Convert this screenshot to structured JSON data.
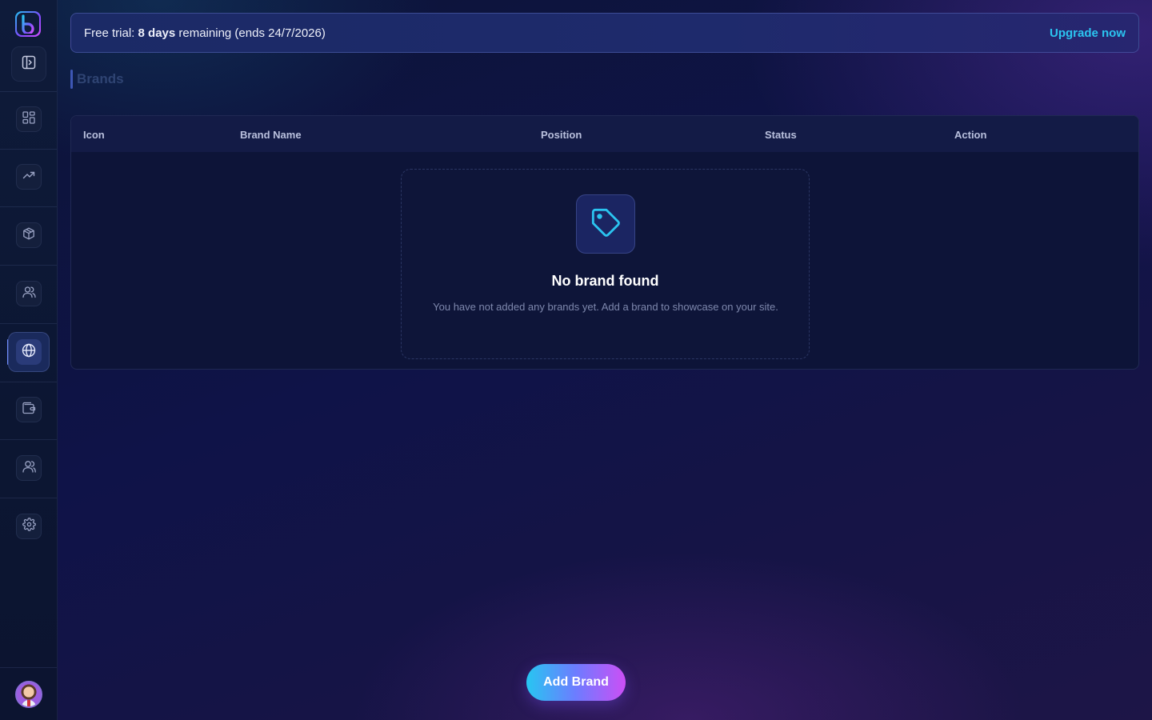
{
  "sidebar": {
    "logo_icon": "app-logo-b-icon",
    "collapse_icon": "sidebar-toggle-icon",
    "items": [
      {
        "icon": "dashboard-grid-icon",
        "active": false
      },
      {
        "icon": "trending-up-icon",
        "active": false
      },
      {
        "icon": "package-box-icon",
        "active": false
      },
      {
        "icon": "users-icon",
        "active": false
      },
      {
        "icon": "globe-icon",
        "active": true
      },
      {
        "icon": "wallet-icon",
        "active": false
      },
      {
        "icon": "team-users-icon",
        "active": false
      },
      {
        "icon": "settings-gear-icon",
        "active": false
      }
    ],
    "avatar_icon": "user-avatar"
  },
  "banner": {
    "prefix": "Free trial: ",
    "days": "8 days",
    "suffix": " remaining (ends 24/7/2026)",
    "upgrade_label": "Upgrade now"
  },
  "page": {
    "title": "Brands"
  },
  "table": {
    "columns": [
      "Icon",
      "Brand Name",
      "Position",
      "Status",
      "Action"
    ],
    "empty": {
      "icon": "tag-icon",
      "title": "No brand found",
      "description": "You have not added any brands yet. Add a brand to showcase on your site."
    }
  },
  "actions": {
    "add_brand_label": "Add Brand"
  },
  "colors": {
    "accent_cyan": "#2bc4f0",
    "accent_purple": "#cc4ff5",
    "active_indicator": "#6f8cff"
  }
}
